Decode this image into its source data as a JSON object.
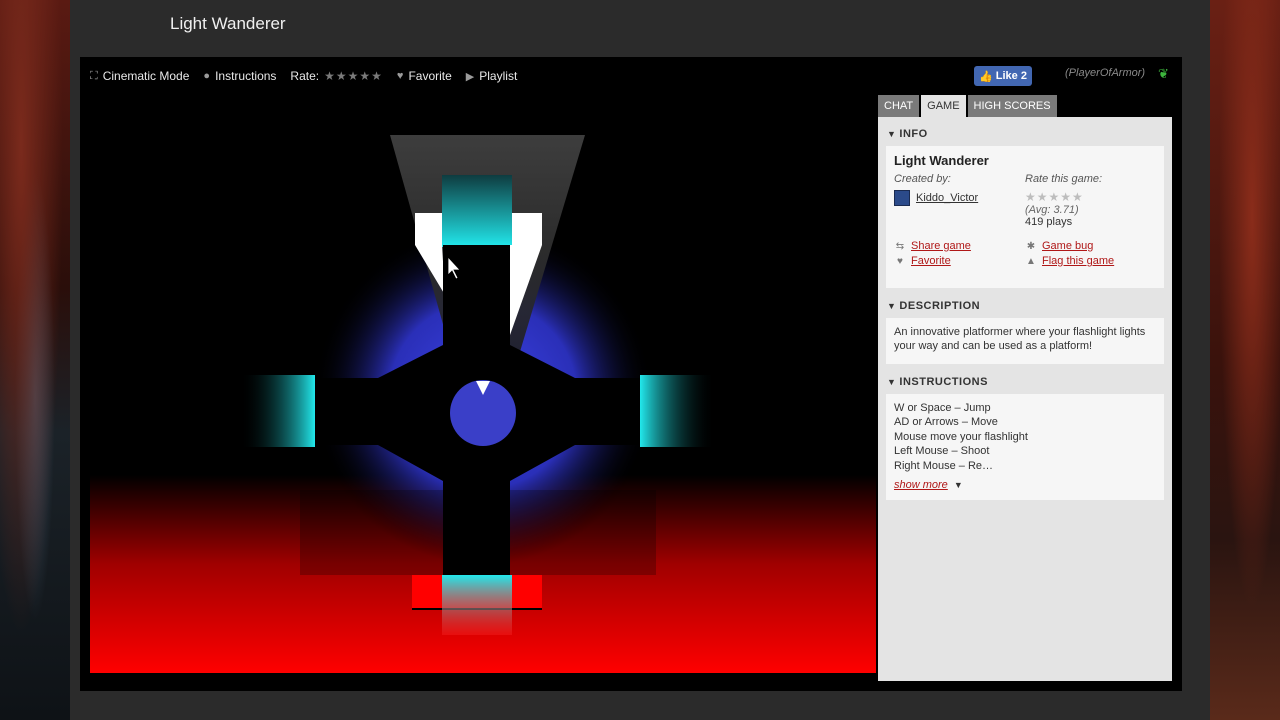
{
  "page": {
    "title": "Light Wanderer"
  },
  "toolbar": {
    "cinematic": "Cinematic Mode",
    "instructions": "Instructions",
    "rate": "Rate:",
    "favorite": "Favorite",
    "playlist": "Playlist"
  },
  "facebook": {
    "like_label": "Like 2"
  },
  "player_name": "(PlayerOfArmor)",
  "tabs": [
    {
      "label": "CHAT"
    },
    {
      "label": "GAME"
    },
    {
      "label": "HIGH SCORES"
    }
  ],
  "info": {
    "heading": "INFO",
    "game_title": "Light Wanderer",
    "created_by_label": "Created by:",
    "author": "Kiddo_Victor",
    "rate_label": "Rate this game:",
    "avg": "(Avg: 3.71)",
    "plays": "419 plays",
    "share": "Share game",
    "favorite": "Favorite",
    "bug": "Game bug",
    "flag": "Flag this game"
  },
  "description": {
    "heading": "DESCRIPTION",
    "text": "An innovative platformer where your flashlight lights your way and can be used as a platform!"
  },
  "instructions": {
    "heading": "INSTRUCTIONS",
    "lines": [
      "W or Space – Jump",
      "AD or Arrows – Move",
      "Mouse move your flashlight",
      "Left Mouse – Shoot",
      "Right Mouse – Re…"
    ],
    "show_more": "show more"
  },
  "colors": {
    "accent_link": "#b01818",
    "fb_blue": "#4267b2",
    "cyan": "#22e0e8",
    "blue_glow": "#2d33c8",
    "red_floor": "#ff0000"
  }
}
